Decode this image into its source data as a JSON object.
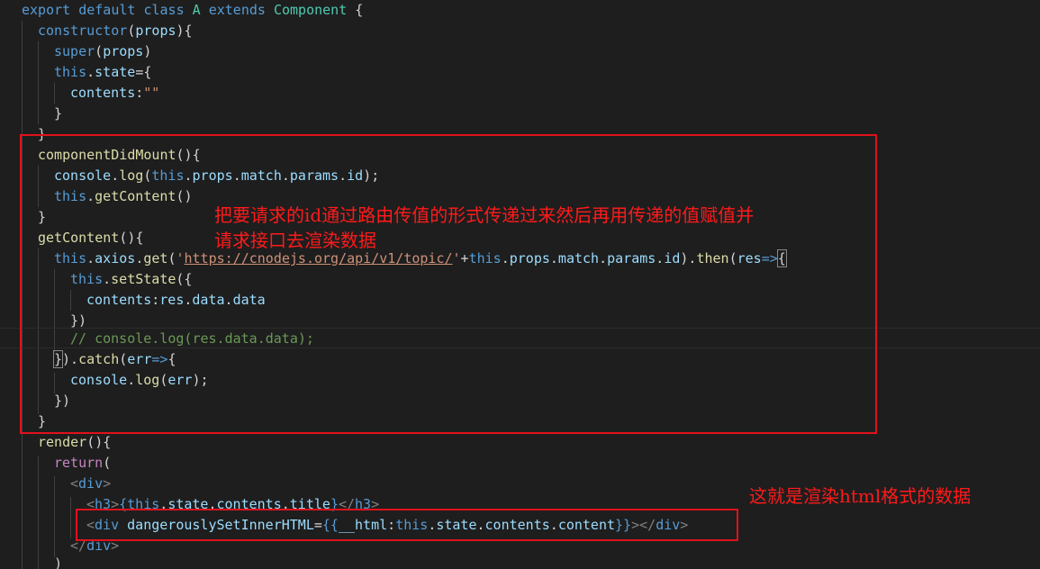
{
  "code": {
    "lines": [
      [
        "export default",
        "class",
        "A",
        "extends",
        "Component",
        "{"
      ],
      [
        "constructor",
        "(",
        "props",
        "){"
      ],
      [
        "super",
        "(",
        "props",
        ")"
      ],
      [
        "this",
        ".",
        "state",
        "={"
      ],
      [
        "contents",
        ":",
        "\"\""
      ],
      [
        "}"
      ],
      [
        "}"
      ],
      [
        "componentDidMount",
        "(){"
      ],
      [
        "console",
        ".",
        "log",
        "(",
        "this",
        ".",
        "props",
        ".",
        "match",
        ".",
        "params",
        ".",
        "id",
        ");"
      ],
      [
        "this",
        ".",
        "getContent",
        "()"
      ],
      [
        "}"
      ],
      [
        "getContent",
        "(){"
      ],
      [
        "this",
        ".",
        "axios",
        ".",
        "get",
        "(",
        "'",
        "https://cnodejs.org/api/v1/topic/",
        "'",
        "+",
        "this",
        ".",
        "props",
        ".",
        "match",
        ".",
        "params",
        ".",
        "id",
        ").",
        "then",
        "(",
        "res",
        "=>",
        "{"
      ],
      [
        "this",
        ".",
        "setState",
        "({"
      ],
      [
        "contents",
        ":",
        "res",
        ".",
        "data",
        ".",
        "data"
      ],
      [
        "})"
      ],
      [
        "// console.log(res.data.data);"
      ],
      [
        "}",
        ").",
        "catch",
        "(",
        "err",
        "=>",
        "{"
      ],
      [
        "console",
        ".",
        "log",
        "(",
        "err",
        ");"
      ],
      [
        "})"
      ],
      [
        "}"
      ],
      [
        "render",
        "(){"
      ],
      [
        "return",
        "("
      ],
      [
        "<",
        "div",
        ">"
      ],
      [
        "<",
        "h3",
        ">",
        "{",
        "this",
        ".",
        "state",
        ".",
        "contents",
        ".",
        "title",
        "}",
        "</",
        "h3",
        ">"
      ],
      [
        "<",
        "div",
        " ",
        "dangerouslySetInnerHTML",
        "=",
        "{{",
        "__html",
        ":",
        "this",
        ".",
        "state",
        ".",
        "contents",
        ".",
        "content",
        "}}",
        "></",
        "div",
        ">"
      ],
      [
        "</",
        "div",
        ">"
      ],
      [
        ")"
      ]
    ]
  },
  "annotations": {
    "note1_line1": "把要请求的id通过路由传值的形式传递过来然后再用传递的值赋值并",
    "note1_line2": "请求接口去渲染数据",
    "note2": "这就是渲染html格式的数据"
  },
  "colors": {
    "background": "#1e1e1e",
    "annotation": "#e0121c"
  }
}
